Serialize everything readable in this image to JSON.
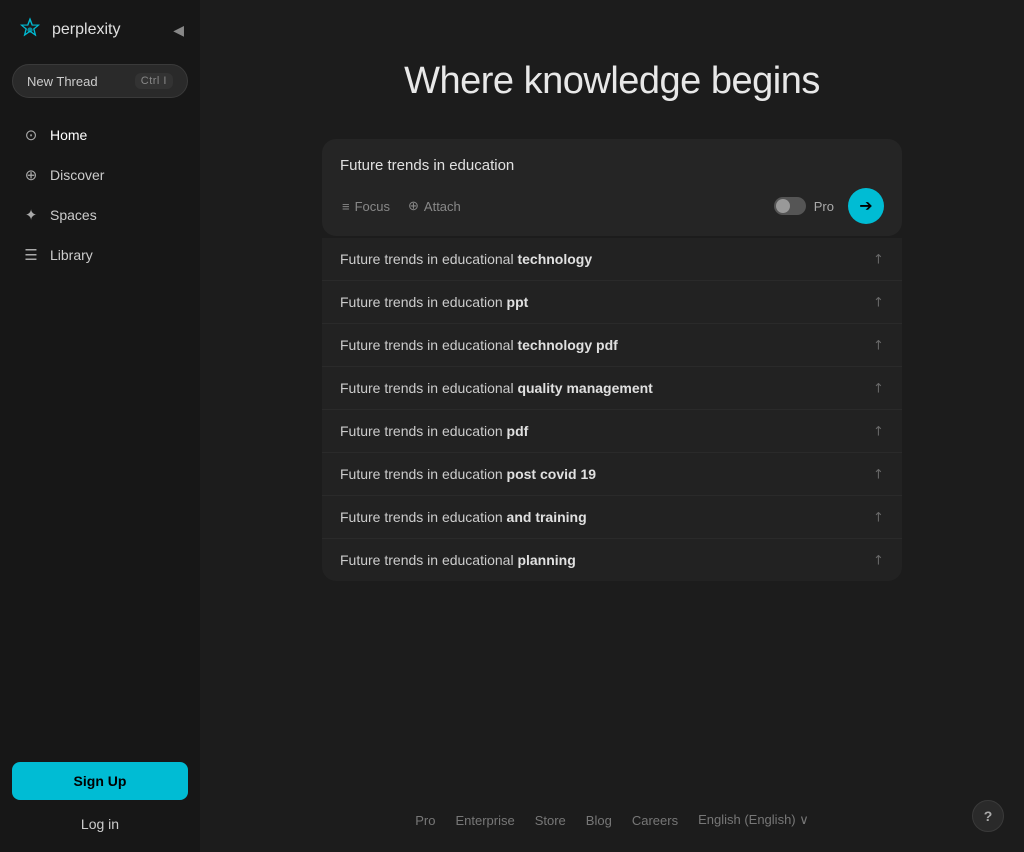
{
  "app": {
    "name": "perplexity"
  },
  "sidebar": {
    "collapse_icon": "◀",
    "new_thread_label": "New Thread",
    "new_thread_shortcut": "Ctrl I",
    "nav_items": [
      {
        "id": "home",
        "label": "Home",
        "icon": "⊙",
        "active": true
      },
      {
        "id": "discover",
        "label": "Discover",
        "icon": "⊕"
      },
      {
        "id": "spaces",
        "label": "Spaces",
        "icon": "✦"
      },
      {
        "id": "library",
        "label": "Library",
        "icon": "☰"
      }
    ],
    "signup_label": "Sign Up",
    "login_label": "Log in"
  },
  "main": {
    "title": "Where knowledge begins",
    "search": {
      "placeholder": "Future trends in education",
      "value": "Future trends in education",
      "focus_label": "Focus",
      "attach_label": "Attach",
      "pro_label": "Pro"
    },
    "suggestions": [
      {
        "text": "Future trends in educational",
        "bold": "technology"
      },
      {
        "text": "Future trends in education",
        "bold": "ppt"
      },
      {
        "text": "Future trends in educational",
        "bold": "technology pdf"
      },
      {
        "text": "Future trends in educational",
        "bold": "quality management"
      },
      {
        "text": "Future trends in education",
        "bold": "pdf"
      },
      {
        "text": "Future trends in education",
        "bold": "post covid 19"
      },
      {
        "text": "Future trends in education",
        "bold": "and training"
      },
      {
        "text": "Future trends in educational",
        "bold": "planning"
      }
    ]
  },
  "footer": {
    "links": [
      {
        "label": "Pro"
      },
      {
        "label": "Enterprise"
      },
      {
        "label": "Store"
      },
      {
        "label": "Blog"
      },
      {
        "label": "Careers"
      },
      {
        "label": "English (English)"
      }
    ],
    "help_icon": "?"
  }
}
